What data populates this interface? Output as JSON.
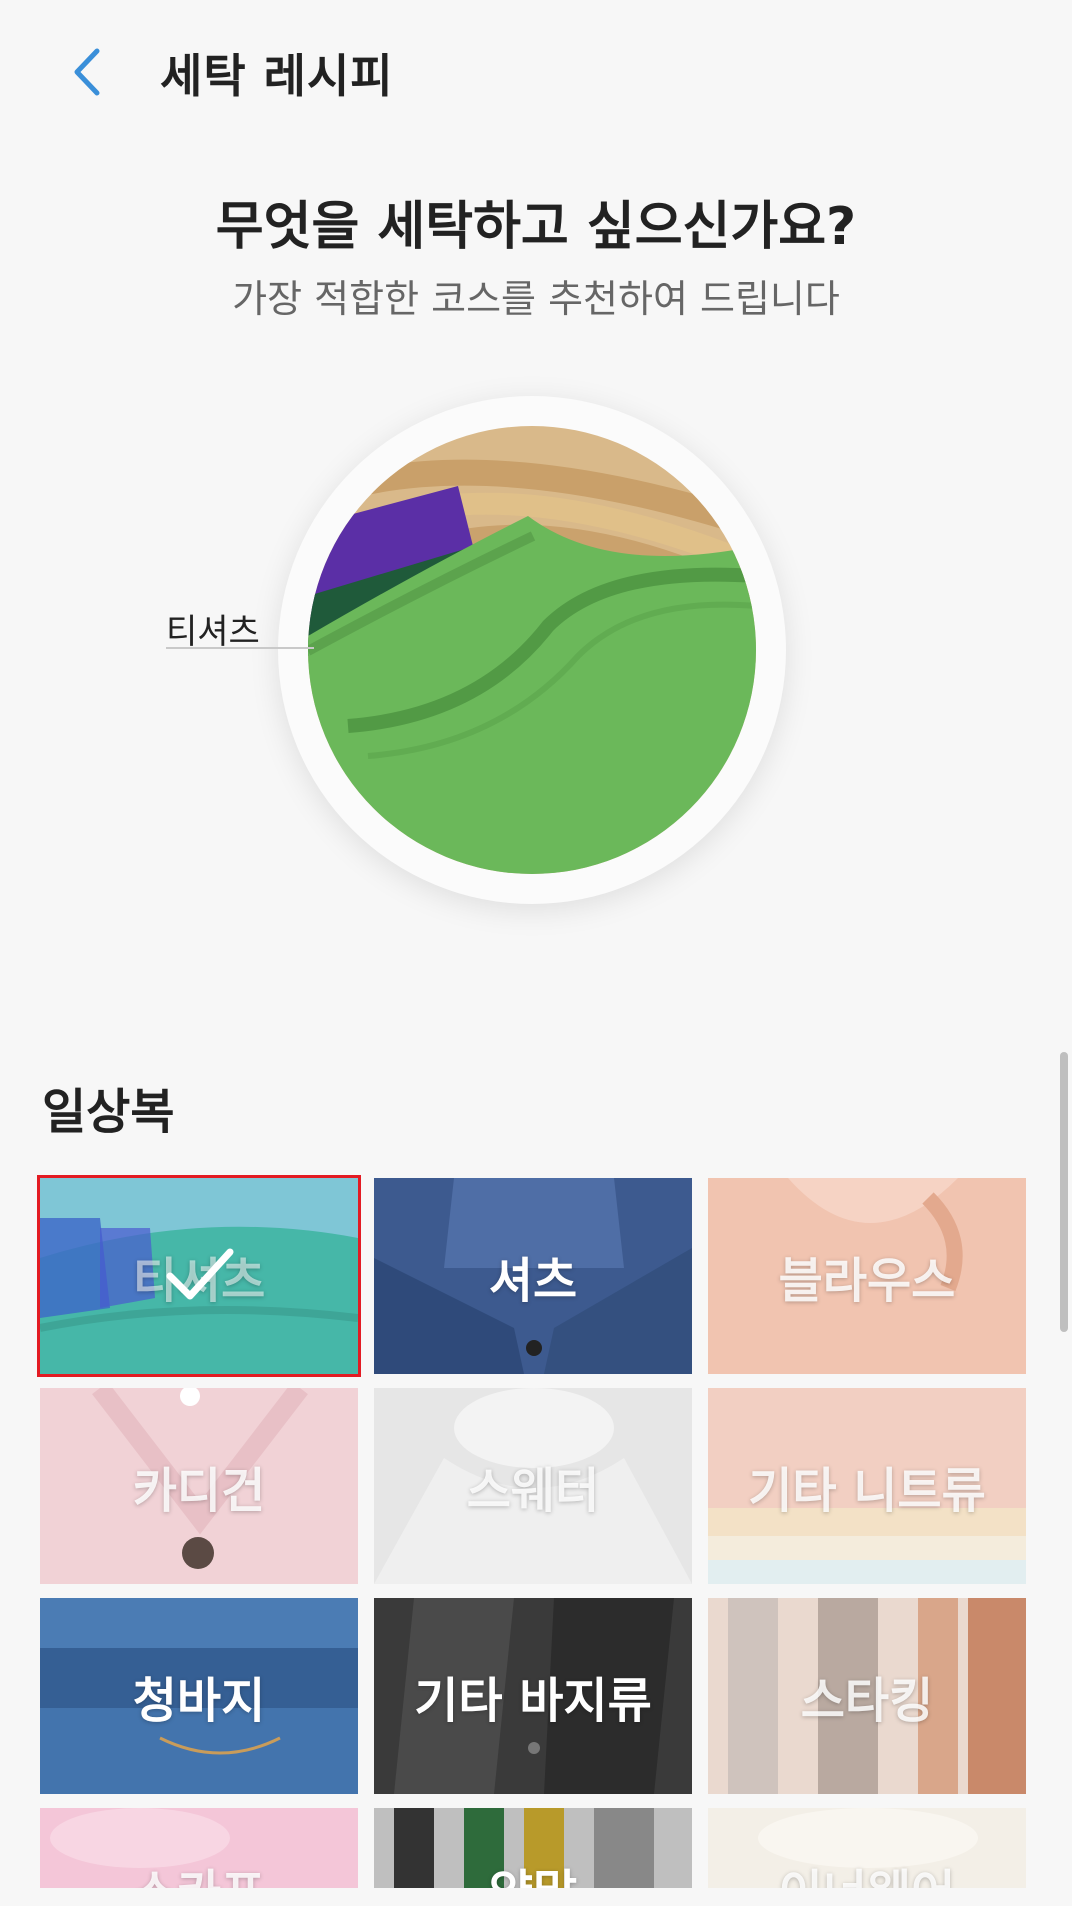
{
  "header": {
    "title": "세탁 레시피",
    "back_icon": "chevron-left-icon",
    "accent": "#3a8fd9"
  },
  "intro": {
    "question": "무엇을 세탁하고 싶으신가요?",
    "subtitle": "가장 적합한 코스를 추천하여 드립니다"
  },
  "preview": {
    "label": "티셔츠"
  },
  "section": {
    "title": "일상복"
  },
  "items": [
    {
      "label": "티셔츠",
      "selected": true
    },
    {
      "label": "셔츠",
      "selected": false
    },
    {
      "label": "블라우스",
      "selected": false
    },
    {
      "label": "카디건",
      "selected": false
    },
    {
      "label": "스웨터",
      "selected": false
    },
    {
      "label": "기타 니트류",
      "selected": false
    },
    {
      "label": "청바지",
      "selected": false
    },
    {
      "label": "기타 바지류",
      "selected": false
    },
    {
      "label": "스타킹",
      "selected": false
    },
    {
      "label": "스카프",
      "selected": false
    },
    {
      "label": "양말",
      "selected": false
    },
    {
      "label": "이너웨어",
      "selected": false
    }
  ],
  "selection_color": "#e31b23"
}
